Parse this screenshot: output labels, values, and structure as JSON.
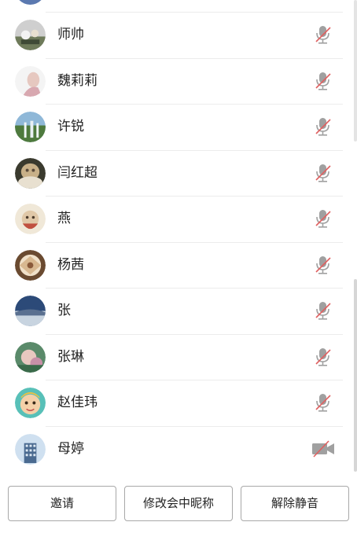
{
  "participants": [
    {
      "name": "师帅",
      "status_icon": "mic-muted-icon"
    },
    {
      "name": "魏莉莉",
      "status_icon": "mic-muted-icon"
    },
    {
      "name": "许锐",
      "status_icon": "mic-muted-icon"
    },
    {
      "name": "闫红超",
      "status_icon": "mic-muted-icon"
    },
    {
      "name": "燕",
      "status_icon": "mic-muted-icon"
    },
    {
      "name": "杨茜",
      "status_icon": "mic-muted-icon"
    },
    {
      "name": "张",
      "status_icon": "mic-muted-icon"
    },
    {
      "name": "张琳",
      "status_icon": "mic-muted-icon"
    },
    {
      "name": "赵佳玮",
      "status_icon": "mic-muted-icon"
    },
    {
      "name": "母婷",
      "status_icon": "camera-off-icon"
    }
  ],
  "actions": {
    "invite_label": "邀请",
    "rename_label": "修改会中昵称",
    "unmute_label": "解除静音"
  },
  "colors": {
    "muted_icon_gray": "#a0a0a0",
    "muted_slash_red": "#e06060",
    "button_border": "#a8a8a8"
  }
}
